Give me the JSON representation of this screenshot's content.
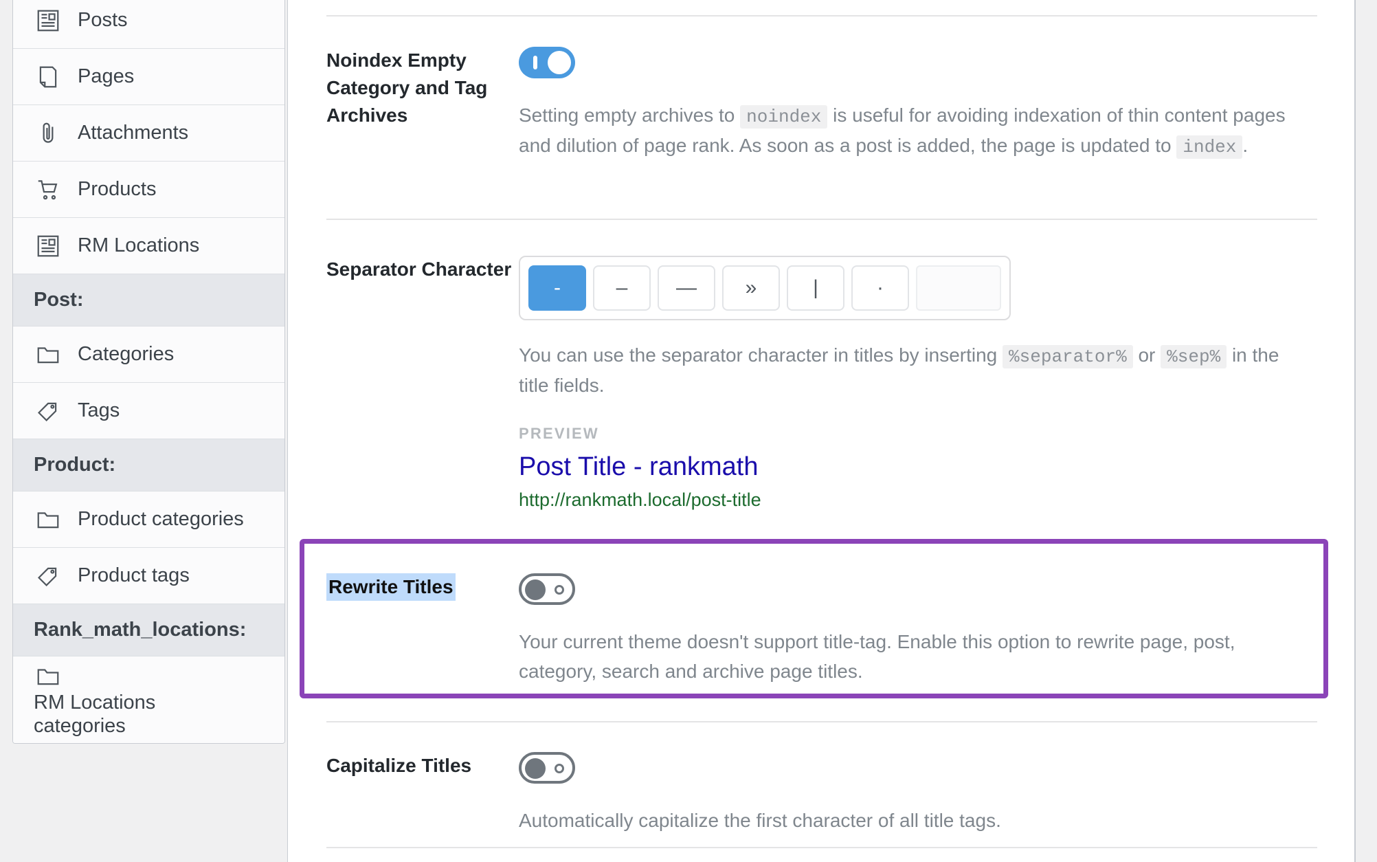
{
  "sidebar": {
    "items": [
      {
        "label": "Posts",
        "icon": "article-icon",
        "type": "item"
      },
      {
        "label": "Pages",
        "icon": "page-icon",
        "type": "item"
      },
      {
        "label": "Attachments",
        "icon": "paperclip-icon",
        "type": "item"
      },
      {
        "label": "Products",
        "icon": "cart-icon",
        "type": "item"
      },
      {
        "label": "RM Locations",
        "icon": "article-icon",
        "type": "item"
      },
      {
        "label": "Post:",
        "icon": "",
        "type": "header"
      },
      {
        "label": "Categories",
        "icon": "folder-icon",
        "type": "item"
      },
      {
        "label": "Tags",
        "icon": "tag-icon",
        "type": "item"
      },
      {
        "label": "Product:",
        "icon": "",
        "type": "header"
      },
      {
        "label": "Product categories",
        "icon": "folder-icon",
        "type": "item"
      },
      {
        "label": "Product tags",
        "icon": "tag-icon",
        "type": "item"
      },
      {
        "label": "Rank_math_locations:",
        "icon": "",
        "type": "header"
      },
      {
        "label": "RM Locations categories",
        "icon": "folder-icon",
        "type": "item"
      }
    ]
  },
  "settings": {
    "noindex": {
      "label": "Noindex Empty Category and Tag Archives",
      "toggle_state": "on",
      "desc_part1": "Setting empty archives to",
      "code1": "noindex",
      "desc_part2": "is useful for avoiding indexation of thin content pages and dilution of page rank. As soon as a post is added, the page is updated to",
      "code2": "index",
      "desc_part3": "."
    },
    "separator": {
      "label": "Separator Character",
      "options": [
        {
          "glyph": "-",
          "name": "hyphen",
          "selected": true
        },
        {
          "glyph": "–",
          "name": "en-dash",
          "selected": false
        },
        {
          "glyph": "—",
          "name": "em-dash",
          "selected": false
        },
        {
          "glyph": "»",
          "name": "double-angle-quote",
          "selected": false
        },
        {
          "glyph": "|",
          "name": "pipe",
          "selected": false
        },
        {
          "glyph": "·",
          "name": "middle-dot",
          "selected": false
        }
      ],
      "custom_value": "",
      "custom_placeholder": "",
      "desc_part1": "You can use the separator character in titles by inserting",
      "code1": "%separator%",
      "desc_part2": "or",
      "code2": "%sep%",
      "desc_part3": "in the title fields.",
      "preview_label": "PREVIEW",
      "preview_title": "Post Title - rankmath",
      "preview_url": "http://rankmath.local/post-title"
    },
    "rewrite_titles": {
      "label": "Rewrite Titles",
      "label_selected": true,
      "toggle_state": "off",
      "description": "Your current theme doesn't support title-tag. Enable this option to rewrite page, post, category, search and archive page titles.",
      "highlight_color": "#8b44b8"
    },
    "capitalize_titles": {
      "label": "Capitalize Titles",
      "toggle_state": "off",
      "description": "Automatically capitalize the first character of all title tags."
    }
  },
  "colors": {
    "accent": "#4a9adf",
    "highlight": "#8b44b8",
    "selection": "#bfdbfb",
    "link": "#1a0dab",
    "url": "#1c6b2e"
  }
}
